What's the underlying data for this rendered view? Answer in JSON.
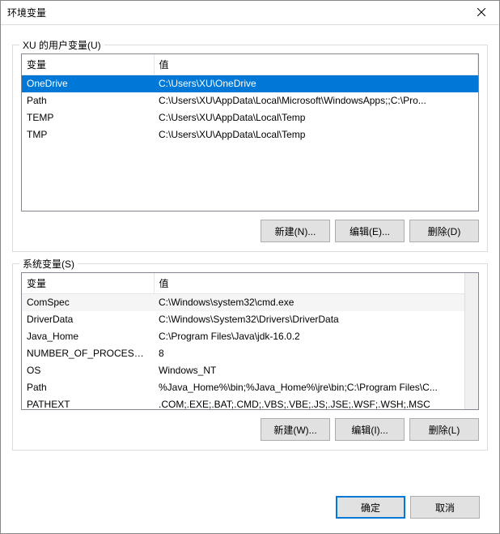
{
  "window": {
    "title": "环境变量"
  },
  "user_section": {
    "legend": "XU 的用户变量(U)",
    "col_var": "变量",
    "col_val": "值",
    "rows": [
      {
        "name": "OneDrive",
        "value": "C:\\Users\\XU\\OneDrive",
        "selected": true
      },
      {
        "name": "Path",
        "value": "C:\\Users\\XU\\AppData\\Local\\Microsoft\\WindowsApps;;C:\\Pro..."
      },
      {
        "name": "TEMP",
        "value": "C:\\Users\\XU\\AppData\\Local\\Temp"
      },
      {
        "name": "TMP",
        "value": "C:\\Users\\XU\\AppData\\Local\\Temp"
      }
    ],
    "btn_new": "新建(N)...",
    "btn_edit": "编辑(E)...",
    "btn_delete": "删除(D)"
  },
  "system_section": {
    "legend": "系统变量(S)",
    "col_var": "变量",
    "col_val": "值",
    "rows": [
      {
        "name": "ComSpec",
        "value": "C:\\Windows\\system32\\cmd.exe",
        "alt": true
      },
      {
        "name": "DriverData",
        "value": "C:\\Windows\\System32\\Drivers\\DriverData"
      },
      {
        "name": "Java_Home",
        "value": "C:\\Program Files\\Java\\jdk-16.0.2"
      },
      {
        "name": "NUMBER_OF_PROCESSORS",
        "value": "8"
      },
      {
        "name": "OS",
        "value": "Windows_NT"
      },
      {
        "name": "Path",
        "value": "%Java_Home%\\bin;%Java_Home%\\jre\\bin;C:\\Program Files\\C..."
      },
      {
        "name": "PATHEXT",
        "value": ".COM;.EXE;.BAT;.CMD;.VBS;.VBE;.JS;.JSE;.WSF;.WSH;.MSC"
      }
    ],
    "btn_new": "新建(W)...",
    "btn_edit": "编辑(I)...",
    "btn_delete": "删除(L)"
  },
  "footer": {
    "ok": "确定",
    "cancel": "取消"
  }
}
